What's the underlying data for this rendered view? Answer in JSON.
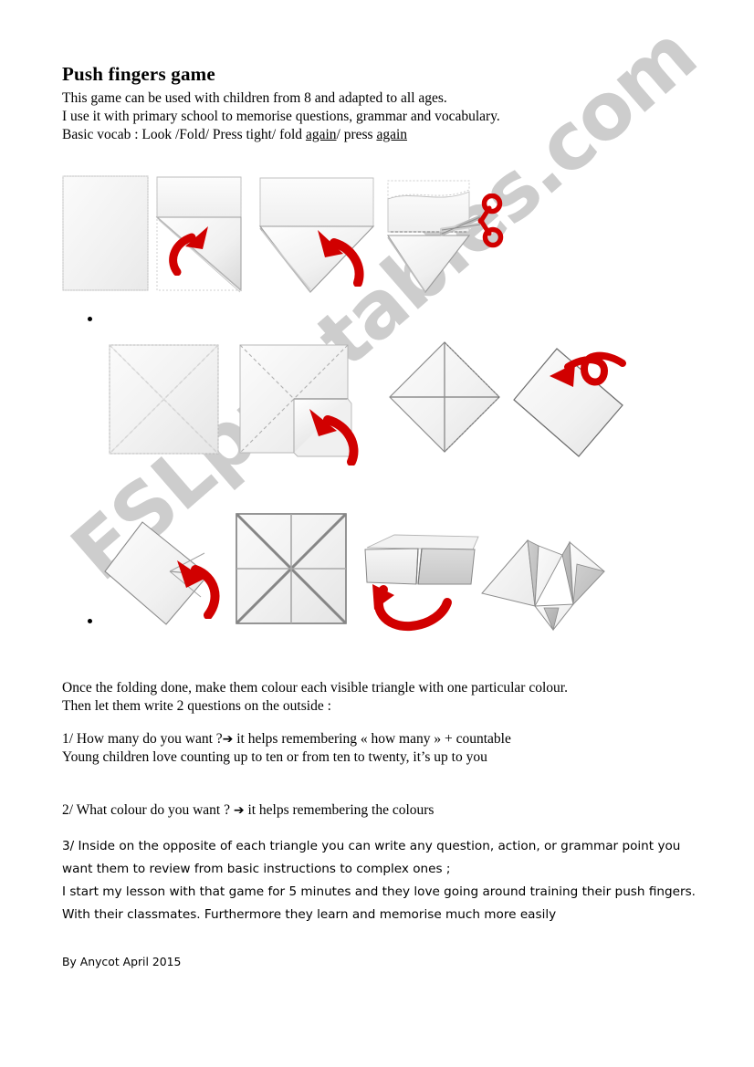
{
  "document": {
    "title": "Push fingers game",
    "intro_lines": [
      "This game can be used with children from 8 and adapted to all ages.",
      "I use it with primary school to memorise questions,  grammar and vocabulary."
    ],
    "basic_vocab": {
      "prefix": "Basic vocab : Look /Fold/ Press tight/ fold ",
      "again_1": "again",
      "middle": "/ press ",
      "again_2": "again"
    },
    "footer": "By Anycot April 2015"
  },
  "watermark": {
    "text": "ESLprintables.com",
    "color": "#c9c9c9"
  },
  "colors": {
    "arrow_red": "#d10000",
    "scissors_red": "#d10000",
    "paper_light": "#f4f4f4",
    "paper_shade": "#c9c9c9",
    "crease_line": "#9a9a9a",
    "text": "#000000"
  },
  "instructions": {
    "intro_para": [
      "Once the folding done, make them colour each visible triangle with one particular colour.",
      "Then let them write 2 questions on the outside :"
    ],
    "item1": {
      "question": "1/ How many do you want ?",
      "arrow": "➔",
      "explanation": " it helps remembering « how many » + countable",
      "note": "Young children love counting up to ten or from ten to twenty, it’s up to you"
    },
    "item2": {
      "question": "2/ What colour do you want ? ",
      "arrow": "➔",
      "explanation": " it helps remembering the colours"
    },
    "item3": {
      "line1": "3/ Inside on the opposite of each triangle you can write any question, action, or grammar point you",
      "line2": "want them to review from basic instructions to complex ones ;",
      "line3": "I start my lesson with that game for 5 minutes and they love going around training their push fingers.",
      "line4": "With their classmates.  Furthermore  they learn and memorise much more easily"
    }
  },
  "diagrams": {
    "row1": [
      {
        "name": "blank-sheet",
        "caption": "plain portrait sheet of paper"
      },
      {
        "name": "fold-corner-diagonal",
        "caption": "fold one corner diagonally, red arrow up-right"
      },
      {
        "name": "fold-triangle-down",
        "caption": "triangle folded down, red arrow up-left"
      },
      {
        "name": "cut-excess-strip",
        "caption": "cut off the excess strip with scissors"
      }
    ],
    "row2": [
      {
        "name": "square-with-x-creases",
        "caption": "square showing X diagonal creases"
      },
      {
        "name": "fold-corner-to-center",
        "caption": "fold corner into the centre, red arrow"
      },
      {
        "name": "diamond-with-cross",
        "caption": "diamond with cross creases"
      },
      {
        "name": "flip-over-diamond",
        "caption": "flip the diamond over, red loop arrow"
      }
    ],
    "row3": [
      {
        "name": "fold-in-half-diamond",
        "caption": "fold in half, red arrow"
      },
      {
        "name": "square-eight-segments",
        "caption": "square divided into eight triangles"
      },
      {
        "name": "booklet-3d",
        "caption": "3D booklet form, red arrow below"
      },
      {
        "name": "finished-cootie-catcher",
        "caption": "finished push fingers / cootie catcher"
      }
    ]
  }
}
